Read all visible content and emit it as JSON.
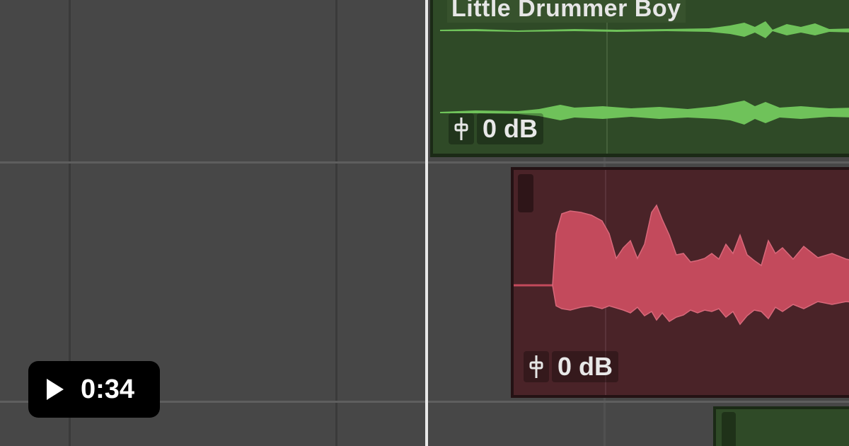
{
  "timeline": {
    "regions": [
      {
        "id": "little-drummer-boy",
        "name": "Little Drummer Boy",
        "gain": "0 dB",
        "color": "#2f4a27",
        "waveform_color": "#6fc25a"
      },
      {
        "id": "vocal-region",
        "name": "",
        "gain": "0 dB",
        "color": "#4a2328",
        "waveform_color": "#c34a5c"
      },
      {
        "id": "lower-region",
        "name": "",
        "color": "#2f4a27"
      }
    ],
    "icons": {
      "gain_icon": "fader-icon"
    }
  },
  "video": {
    "duration": "0:34",
    "play_icon": "play-icon"
  }
}
